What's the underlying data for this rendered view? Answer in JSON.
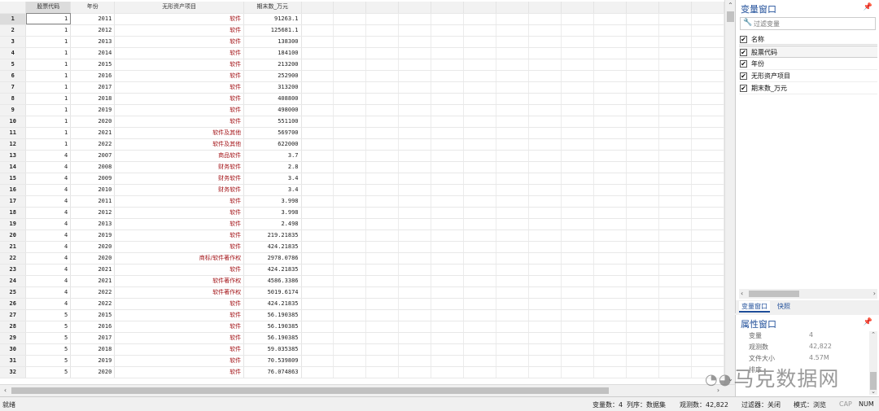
{
  "columns": [
    "股票代码",
    "年份",
    "无形资产项目",
    "期末数_万元"
  ],
  "rows": [
    [
      "1",
      "1",
      "2011",
      "软件",
      "91263.1"
    ],
    [
      "2",
      "1",
      "2012",
      "软件",
      "125681.1"
    ],
    [
      "3",
      "1",
      "2013",
      "软件",
      "138300"
    ],
    [
      "4",
      "1",
      "2014",
      "软件",
      "184100"
    ],
    [
      "5",
      "1",
      "2015",
      "软件",
      "213200"
    ],
    [
      "6",
      "1",
      "2016",
      "软件",
      "252900"
    ],
    [
      "7",
      "1",
      "2017",
      "软件",
      "313200"
    ],
    [
      "8",
      "1",
      "2018",
      "软件",
      "408800"
    ],
    [
      "9",
      "1",
      "2019",
      "软件",
      "498000"
    ],
    [
      "10",
      "1",
      "2020",
      "软件",
      "551100"
    ],
    [
      "11",
      "1",
      "2021",
      "软件及其他",
      "569700"
    ],
    [
      "12",
      "1",
      "2022",
      "软件及其他",
      "622000"
    ],
    [
      "13",
      "4",
      "2007",
      "商品软件",
      "3.7"
    ],
    [
      "14",
      "4",
      "2008",
      "财务软件",
      "2.8"
    ],
    [
      "15",
      "4",
      "2009",
      "财务软件",
      "3.4"
    ],
    [
      "16",
      "4",
      "2010",
      "财务软件",
      "3.4"
    ],
    [
      "17",
      "4",
      "2011",
      "软件",
      "3.998"
    ],
    [
      "18",
      "4",
      "2012",
      "软件",
      "3.998"
    ],
    [
      "19",
      "4",
      "2013",
      "软件",
      "2.498"
    ],
    [
      "20",
      "4",
      "2019",
      "软件",
      "219.21835"
    ],
    [
      "21",
      "4",
      "2020",
      "软件",
      "424.21835"
    ],
    [
      "22",
      "4",
      "2020",
      "商标/软件著作权",
      "2978.0786"
    ],
    [
      "23",
      "4",
      "2021",
      "软件",
      "424.21835"
    ],
    [
      "24",
      "4",
      "2021",
      "软件著作权",
      "4586.3386"
    ],
    [
      "25",
      "4",
      "2022",
      "软件著作权",
      "5019.6174"
    ],
    [
      "26",
      "4",
      "2022",
      "软件",
      "424.21835"
    ],
    [
      "27",
      "5",
      "2015",
      "软件",
      "56.190385"
    ],
    [
      "28",
      "5",
      "2016",
      "软件",
      "56.190385"
    ],
    [
      "29",
      "5",
      "2017",
      "软件",
      "56.190385"
    ],
    [
      "30",
      "5",
      "2018",
      "软件",
      "59.035385"
    ],
    [
      "31",
      "5",
      "2019",
      "软件",
      "70.539809"
    ],
    [
      "32",
      "5",
      "2020",
      "软件",
      "76.074863"
    ]
  ],
  "variables_panel": {
    "title": "变量窗口",
    "filter_placeholder": "过滤变量",
    "header_label": "名称",
    "items": [
      "股票代码",
      "年份",
      "无形资产项目",
      "期末数_万元"
    ],
    "tabs": [
      "变量窗口",
      "快照"
    ]
  },
  "properties_panel": {
    "title": "属性窗口",
    "rows": [
      {
        "key": "变量",
        "value": "4"
      },
      {
        "key": "观测数",
        "value": "42,822"
      },
      {
        "key": "文件大小",
        "value": "4.57M"
      },
      {
        "key": "排序",
        "value": ""
      }
    ]
  },
  "statusbar": {
    "ready": "就绪",
    "var_count": "变量数：4",
    "order": "列序：数据集",
    "obs": "观测数：42,822",
    "filter": "过滤器：关闭",
    "mode": "模式：浏览",
    "cap": "CAP",
    "num": "NUM"
  },
  "watermark": "马克数据网",
  "colors": {
    "string_value": "#a4161a",
    "panel_title": "#1f4e99"
  }
}
